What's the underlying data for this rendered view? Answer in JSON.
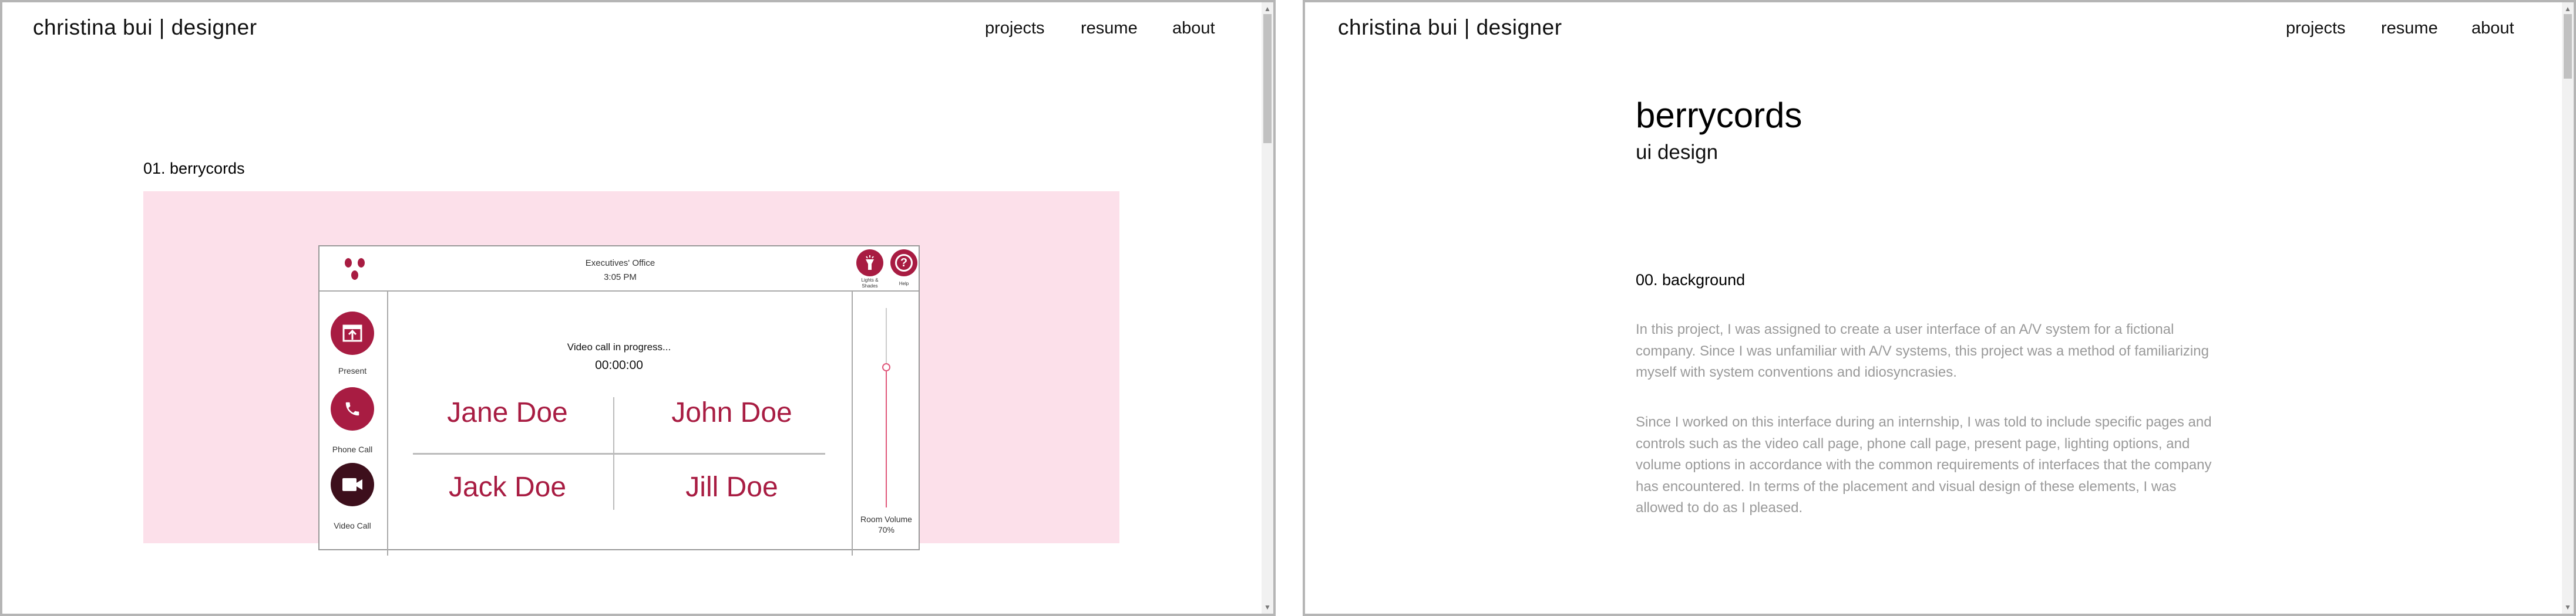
{
  "left_window": {
    "brand": "christina bui | designer",
    "nav": [
      "projects",
      "resume",
      "about"
    ],
    "section_title": "01. berrycords",
    "mockup": {
      "room": "Executives' Office",
      "time": "3:05 PM",
      "top_actions": [
        {
          "label": "Lights & Shades",
          "icon": "flashlight-icon"
        },
        {
          "label": "Help",
          "icon": "help-icon"
        }
      ],
      "side_actions": [
        {
          "label": "Present",
          "icon": "present-icon",
          "color": "#a81c42"
        },
        {
          "label": "Phone Call",
          "icon": "phone-icon",
          "color": "#a81c42"
        },
        {
          "label": "Video Call",
          "icon": "video-camera-icon",
          "color": "#3d0f1c"
        }
      ],
      "status": "Video call in progress...",
      "timer": "00:00:00",
      "participants": [
        "Jane Doe",
        "John Doe",
        "Jack Doe",
        "Jill Doe"
      ],
      "volume_label": "Room Volume",
      "volume_value": "70%",
      "volume_level": 0.7
    }
  },
  "right_window": {
    "brand": "christina bui | designer",
    "nav": [
      "projects",
      "resume",
      "about"
    ],
    "title": "berrycords",
    "subtitle": "ui design",
    "section_title": "00. background",
    "paragraphs": [
      "In this project, I was assigned to create a user interface of an A/V system for a fictional company. Since I was unfamiliar with A/V systems, this project was a method of familiarizing myself with system conventions and idiosyncrasies.",
      "Since I worked on this interface during an internship, I was told to include specific pages and controls such as the video call page, phone call page, present page, lighting options, and volume options in accordance with the common requirements of interfaces that the company has encountered. In terms of the placement and visual design of these elements, I was allowed to do as I pleased."
    ]
  },
  "colors": {
    "accent": "#a81c42",
    "accent_dark": "#3d0f1c",
    "hero_bg": "#fce0ea",
    "body_text": "#9a9a9a"
  }
}
